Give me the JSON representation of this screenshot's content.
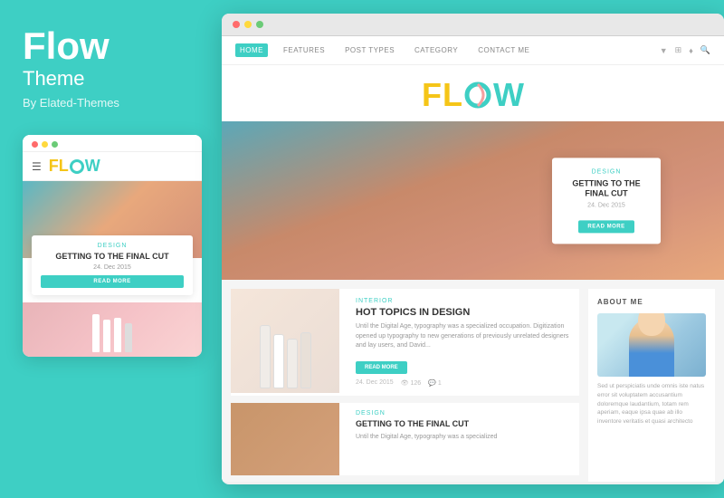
{
  "brand": {
    "title": "Flow",
    "subtitle": "Theme",
    "by": "By Elated-Themes"
  },
  "logo": {
    "letters": {
      "fl": "FL",
      "w": "W"
    }
  },
  "nav": {
    "links": [
      {
        "label": "HOME",
        "active": true
      },
      {
        "label": "FEATURES",
        "active": false
      },
      {
        "label": "POST TYPES",
        "active": false
      },
      {
        "label": "CATEGORY",
        "active": false
      },
      {
        "label": "CONTACT ME",
        "active": false
      }
    ]
  },
  "hero": {
    "tag": "DESIGN",
    "title": "GETTING TO THE FINAL CUT",
    "date": "24. Dec 2015",
    "button": "READ MORE"
  },
  "article1": {
    "tag": "INTERIOR",
    "title": "HOT TOPICS IN DESIGN",
    "body": "Until the Digital Age, typography was a specialized occupation. Digitization opened up typography to new generations of previously unrelated designers and lay users, and David...",
    "button": "READ MORE",
    "date": "24. Dec 2015",
    "views": "126",
    "comments": "1"
  },
  "article2": {
    "tag": "DESIGN",
    "title": "GETTING TO THE FINAL CUT",
    "body": "Until the Digital Age, typography was a specialized"
  },
  "sidebar": {
    "about_label": "ABOUT ME",
    "about_text": "Sed ut perspiciatis unde omnis iste natus error sit voluptatem accusantium doloremque laudantium, totam rem aperiam, eaque ipsa quae ab illo inventore veritatis et quasi architecto"
  },
  "mobile": {
    "card_tag": "DESIGN",
    "card_title": "GETTING TO THE FINAL CUT",
    "card_date": "24. Dec 2015",
    "card_button": "READ MORE"
  },
  "colors": {
    "teal": "#3ecfc4",
    "yellow": "#f5c518",
    "red": "#e74c3c",
    "white": "#ffffff",
    "dark": "#333333",
    "gray": "#999999"
  }
}
